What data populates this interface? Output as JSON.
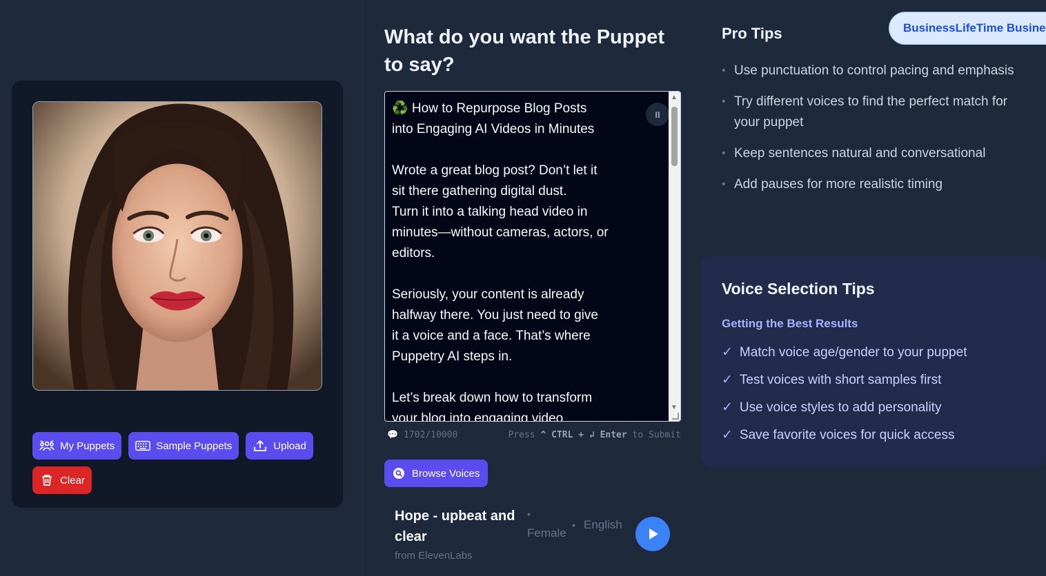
{
  "left": {
    "buttons": {
      "my_puppets": "My Puppets",
      "sample_puppets": "Sample Puppets",
      "upload": "Upload",
      "clear": "Clear"
    }
  },
  "prompt": {
    "title": "What do you want the Puppet to say?",
    "text": "♻️ How to Repurpose Blog Posts\ninto Engaging AI Videos in Minutes\n\nWrote a great blog post? Don’t let it\nsit there gathering digital dust.\nTurn it into a talking head video in\nminutes—without cameras, actors, or\neditors.\n\nSeriously, your content is already\nhalfway there. You just need to give\nit a voice and a face. That’s where\nPuppetry AI steps in.\n\nLet’s break down how to transform\nyour blog into engaging video",
    "counter": "1702/10000",
    "submit_hint_prefix": "Press",
    "submit_hint_keys": "^ CTRL + ↲ Enter",
    "submit_hint_suffix": "to Submit"
  },
  "browse_voices": "Browse Voices",
  "voice": {
    "name": "Hope - upbeat and clear",
    "gender": "Female",
    "language": "English",
    "source": "from ElevenLabs"
  },
  "plan_badge": "BusinessLifeTime Business",
  "pro_tips": {
    "title": "Pro Tips",
    "items": [
      "Use punctuation to control pacing and emphasis",
      "Try different voices to find the perfect match for your puppet",
      "Keep sentences natural and conversational",
      "Add pauses for more realistic timing"
    ]
  },
  "voice_tips": {
    "title": "Voice Selection Tips",
    "subtitle": "Getting the Best Results",
    "items": [
      "Match voice age/gender to your puppet",
      "Test voices with short samples first",
      "Use voice styles to add personality",
      "Save favorite voices for quick access"
    ]
  },
  "colors": {
    "background": "#1e293b",
    "accent": "#5b4cf0",
    "danger": "#dc2626",
    "play": "#3b82f6"
  }
}
